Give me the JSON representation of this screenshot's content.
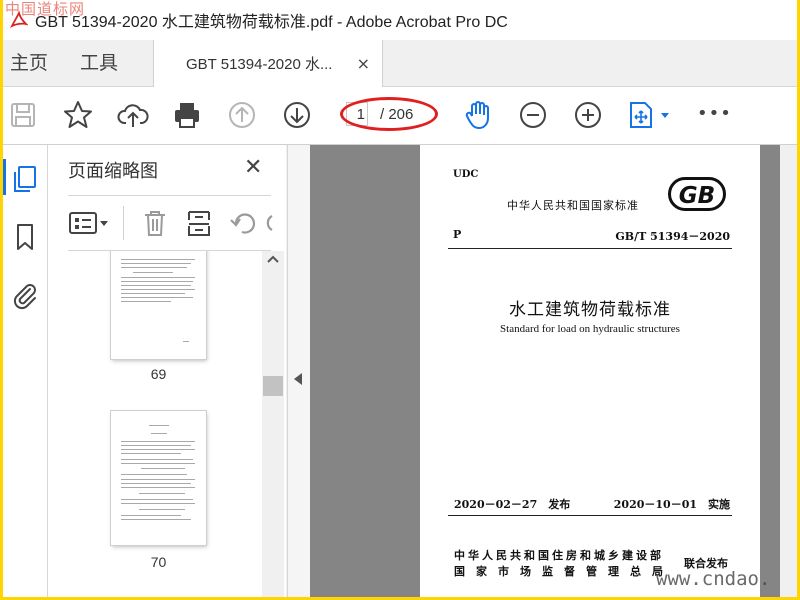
{
  "window": {
    "title": "GBT 51394-2020 水工建筑物荷载标准.pdf - Adobe Acrobat Pro DC",
    "watermark_top": "中国道标网",
    "watermark_bottom": "www.cndao."
  },
  "tabs": {
    "home": "主页",
    "tools": "工具",
    "document": "GBT 51394-2020 水...",
    "close": "×"
  },
  "toolbar": {
    "icons": [
      "save-icon",
      "star-icon",
      "cloud-upload-icon",
      "print-icon",
      "page-up-icon",
      "page-down-icon",
      "hand-tool-icon",
      "zoom-out-icon",
      "zoom-in-icon",
      "fit-page-icon",
      "more-icon"
    ],
    "current_page": "1",
    "total_pages": "/ 206",
    "more": "•••"
  },
  "panel": {
    "title": "页面缩略图",
    "close": "✕",
    "thumbnails": [
      {
        "page": "69"
      },
      {
        "page": "70"
      }
    ]
  },
  "document": {
    "udc": "UDC",
    "national_standard": "中华人民共和国国家标准",
    "logo": "GB",
    "category": "P",
    "code": "GB/T 51394－2020",
    "title_cn": "水工建筑物荷载标准",
    "title_en": "Standard for load on hydraulic structures",
    "issue_date": "2020－02－27　发布",
    "implement_date": "2020－10－01　实施",
    "publisher_line1": "中华人民共和国住房和城乡建设部",
    "publisher_line2": "国家市场监督管理总局",
    "joint_release": "联合发布"
  },
  "colors": {
    "accent": "#1473e6",
    "annotation": "#e02020",
    "border": "#ffd400"
  }
}
